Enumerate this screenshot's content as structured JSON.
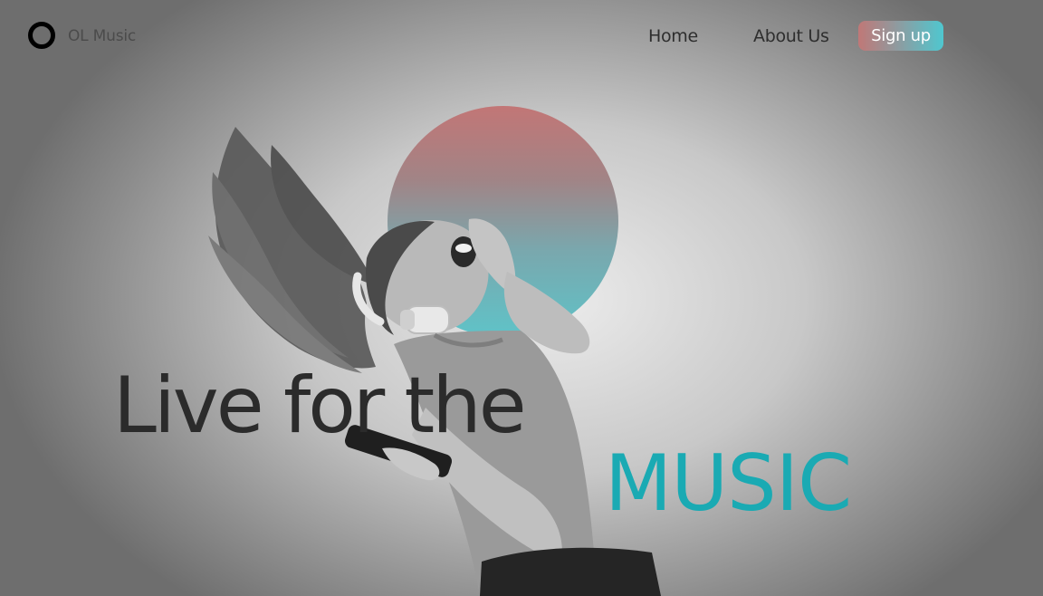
{
  "navbar": {
    "brand": "OL Music",
    "links": [
      "Home",
      "About Us"
    ],
    "signup_label": "Sign up"
  },
  "hero": {
    "headline": "Live for the",
    "accent_word": "MUSIC",
    "image_subject": "woman-with-headphones-dancing",
    "colors": {
      "accent": "#1aaab3",
      "gradient_top": "#c27676",
      "gradient_bottom": "#5fc3c8"
    }
  }
}
